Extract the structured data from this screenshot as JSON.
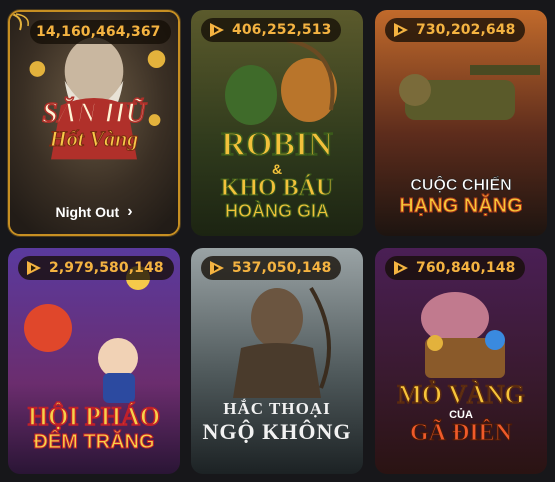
{
  "games": [
    {
      "id": "san-hu-hot-vang",
      "jackpot": "14,160,464,367",
      "title_line1": "SĂN HŨ",
      "title_line2": "Hốt Vàng",
      "action_label": "Night Out",
      "selected": true
    },
    {
      "id": "robin-kho-bau",
      "jackpot": "406,252,513",
      "title_line1": "ROBIN",
      "title_amp": "&",
      "title_line2": "KHO BÁU",
      "title_line3": "HOÀNG GIA"
    },
    {
      "id": "cuoc-chien-hang-nang",
      "jackpot": "730,202,648",
      "title_line1": "CUỘC CHIẾN",
      "title_line2": "HẠNG NẶNG"
    },
    {
      "id": "hoi-phao-dem-trang",
      "jackpot": "2,979,580,148",
      "title_line1": "HỘI PHÁO",
      "title_line2": "ĐÊM TRĂNG"
    },
    {
      "id": "hac-thoai-ngo-khong",
      "jackpot": "537,050,148",
      "title_line1": "HẮC THOẠI",
      "title_line2": "NGỘ KHÔNG"
    },
    {
      "id": "mo-vang-cua-ga-dien",
      "jackpot": "760,840,148",
      "title_line1": "MỎ VÀNG",
      "title_small": "CỦA",
      "title_line2": "GÃ ĐIÊN"
    }
  ],
  "colors": {
    "jackpot_text": "#f4b341",
    "selected_border": "#c78f22",
    "background": "#17171a"
  },
  "icons": {
    "jackpot": "jackpot-coin-icon",
    "chevron": "chevron-right-icon",
    "corner": "star-corner-icon"
  }
}
